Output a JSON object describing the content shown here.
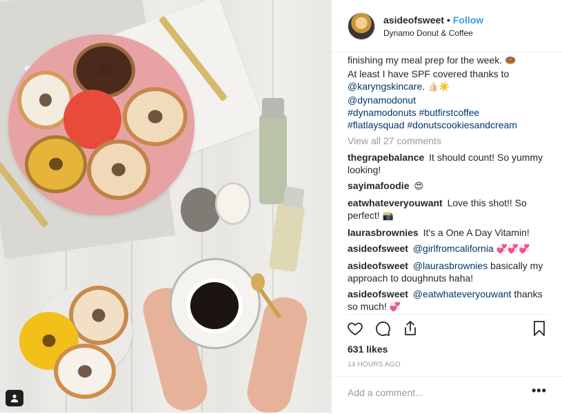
{
  "post": {
    "username": "asideofsweet",
    "separator": "•",
    "follow_label": "Follow",
    "location": "Dynamo Donut & Coffee",
    "caption_lines": [
      {
        "text": "finishing my meal prep for the week. ",
        "emoji": "🍩"
      },
      {
        "text": "At least I have SPF covered thanks to"
      },
      {
        "link": "@karyngskincare",
        "text": ". ",
        "emoji": "👍🏻☀️"
      },
      {
        "link": "@dynamodonut"
      },
      {
        "link": "#dynamodonuts #butfirstcoffee"
      },
      {
        "link": "#flatlaysquad #donutscookiesandcream"
      }
    ],
    "view_all_comments": "View all 27 comments",
    "comments": [
      {
        "user": "thegrapebalance",
        "text": "It should count! So yummy looking!"
      },
      {
        "user": "sayimafoodie",
        "emoji": "😍"
      },
      {
        "user": "eatwhateveryouwant",
        "text": "Love this shot!! So perfect!",
        "emoji": "📸"
      },
      {
        "user": "laurasbrownies",
        "text": "It's a One A Day Vitamin!"
      },
      {
        "user": "asideofsweet",
        "mention": "@girlfromcalifornia",
        "emoji": "💞💞💞"
      },
      {
        "user": "asideofsweet",
        "mention": "@laurasbrownies",
        "text": "basically my approach to doughnuts haha!"
      },
      {
        "user": "asideofsweet",
        "mention": "@eatwhateveryouwant",
        "text": "thanks so much!",
        "emoji": "💞"
      }
    ],
    "likes": "631 likes",
    "timestamp": "14 HOURS AGO",
    "comment_placeholder": "Add a comment...",
    "more_options": "•••"
  },
  "icons": {
    "like": "heart-icon",
    "comment": "comment-icon",
    "share": "share-icon",
    "save": "bookmark-icon",
    "user_tag": "user-tag-icon"
  },
  "colors": {
    "link": "#003569",
    "follow": "#3897f0",
    "muted": "#999999",
    "text": "#262626"
  }
}
